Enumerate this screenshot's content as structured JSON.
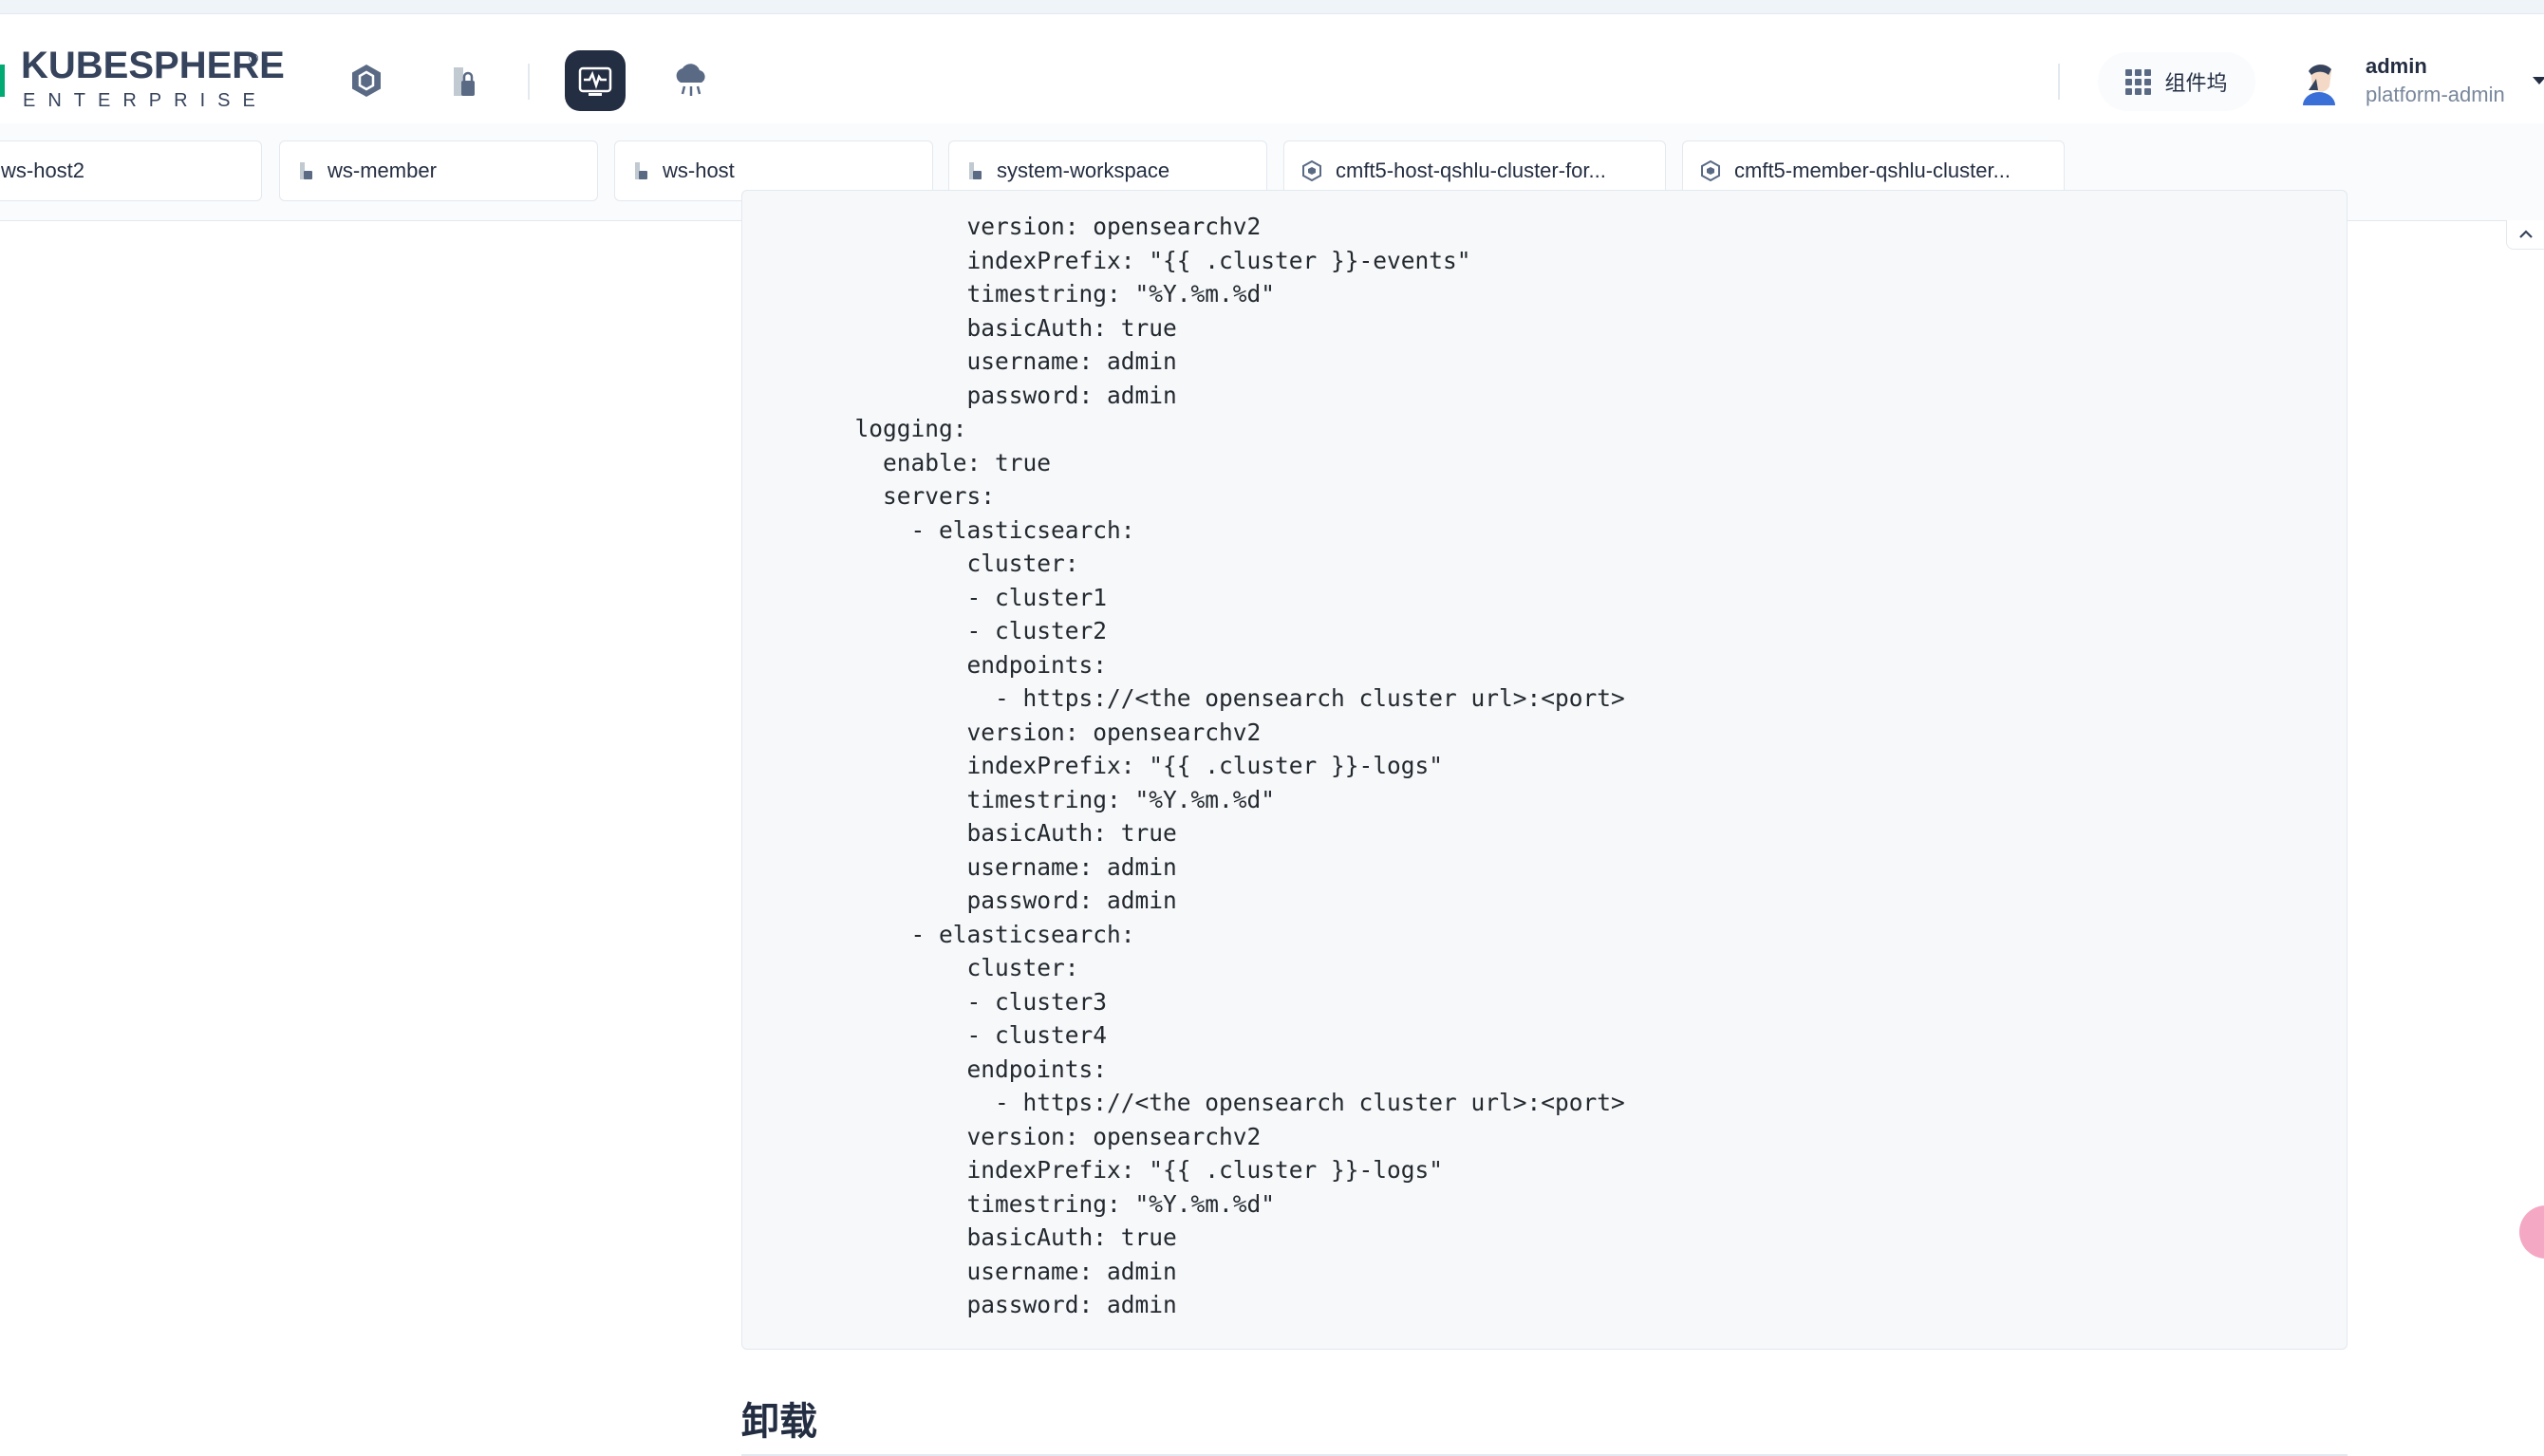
{
  "header": {
    "logo_text": "KUBESPHERE",
    "logo_registered": "®",
    "logo_sub": "ENTERPRISE",
    "nav_icons": [
      "cluster-hexagon-icon",
      "workspace-building-icon",
      "monitoring-pulse-icon",
      "cloud-rain-icon"
    ],
    "active_nav": "monitoring-pulse-icon",
    "apps_label": "组件坞",
    "user_name": "admin",
    "user_role": "platform-admin"
  },
  "tabs": [
    {
      "label": "ws-host2",
      "icon": "workspace-icon"
    },
    {
      "label": "ws-member",
      "icon": "workspace-icon"
    },
    {
      "label": "ws-host",
      "icon": "workspace-icon"
    },
    {
      "label": "system-workspace",
      "icon": "workspace-icon"
    },
    {
      "label": "cmft5-host-qshlu-cluster-for...",
      "icon": "cluster-icon"
    },
    {
      "label": "cmft5-member-qshlu-cluster...",
      "icon": "cluster-icon"
    }
  ],
  "code": {
    "lines": [
      "          version: opensearchv2",
      "          indexPrefix: \"{{ .cluster }}-events\"",
      "          timestring: \"%Y.%m.%d\"",
      "          basicAuth: true",
      "          username: admin",
      "          password: admin",
      "  logging:",
      "    enable: true",
      "    servers:",
      "      - elasticsearch:",
      "          cluster:",
      "          - cluster1",
      "          - cluster2",
      "          endpoints:",
      "            - https://<the opensearch cluster url>:<port>",
      "          version: opensearchv2",
      "          indexPrefix: \"{{ .cluster }}-logs\"",
      "          timestring: \"%Y.%m.%d\"",
      "          basicAuth: true",
      "          username: admin",
      "          password: admin",
      "      - elasticsearch:",
      "          cluster:",
      "          - cluster3",
      "          - cluster4",
      "          endpoints:",
      "            - https://<the opensearch cluster url>:<port>",
      "          version: opensearchv2",
      "          indexPrefix: \"{{ .cluster }}-logs\"",
      "          timestring: \"%Y.%m.%d\"",
      "          basicAuth: true",
      "          username: admin",
      "          password: admin"
    ]
  },
  "section_title": "卸载",
  "colors": {
    "brand_green": "#00aa72",
    "dark": "#242e42",
    "code_bg": "#f6f8fa",
    "float_button": "#f4a8c4"
  }
}
